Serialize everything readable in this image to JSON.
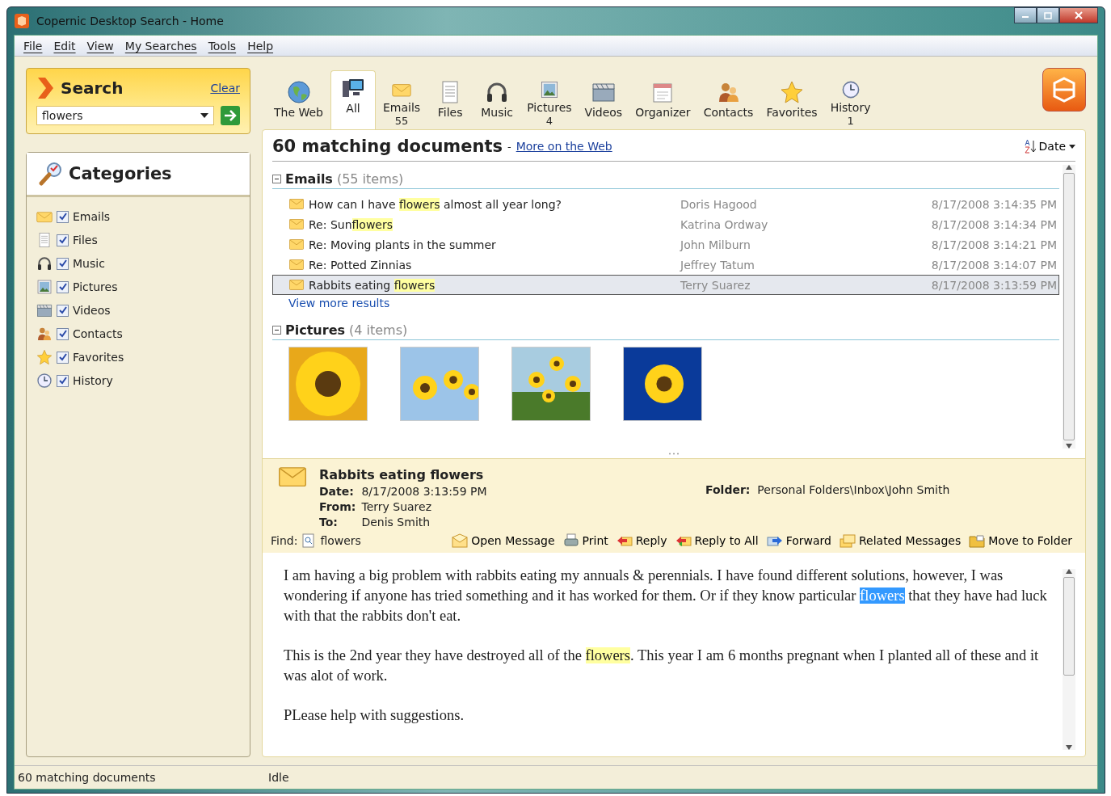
{
  "window": {
    "title": "Copernic Desktop Search - Home"
  },
  "menu": [
    "File",
    "Edit",
    "View",
    "My Searches",
    "Tools",
    "Help"
  ],
  "search": {
    "title": "Search",
    "clear": "Clear",
    "value": "flowers"
  },
  "categories": {
    "title": "Categories",
    "items": [
      {
        "kind": "email",
        "label": "Emails",
        "checked": true
      },
      {
        "kind": "file",
        "label": "Files",
        "checked": true
      },
      {
        "kind": "music",
        "label": "Music",
        "checked": true
      },
      {
        "kind": "picture",
        "label": "Pictures",
        "checked": true
      },
      {
        "kind": "video",
        "label": "Videos",
        "checked": true
      },
      {
        "kind": "contact",
        "label": "Contacts",
        "checked": true
      },
      {
        "kind": "favorite",
        "label": "Favorites",
        "checked": true
      },
      {
        "kind": "history",
        "label": "History",
        "checked": true
      }
    ]
  },
  "tabs": [
    {
      "kind": "web",
      "label": "The Web",
      "selected": false
    },
    {
      "kind": "all",
      "label": "All",
      "selected": true
    },
    {
      "kind": "email",
      "label": "Emails",
      "count": "55",
      "selected": false
    },
    {
      "kind": "file",
      "label": "Files",
      "selected": false
    },
    {
      "kind": "music",
      "label": "Music",
      "selected": false
    },
    {
      "kind": "picture",
      "label": "Pictures",
      "count": "4",
      "selected": false
    },
    {
      "kind": "video",
      "label": "Videos",
      "selected": false
    },
    {
      "kind": "organizer",
      "label": "Organizer",
      "selected": false
    },
    {
      "kind": "contact",
      "label": "Contacts",
      "selected": false
    },
    {
      "kind": "favorite",
      "label": "Favorites",
      "selected": false
    },
    {
      "kind": "history",
      "label": "History",
      "count": "1",
      "selected": false
    }
  ],
  "results": {
    "heading": "60 matching documents",
    "separator": "-",
    "web_link": "More on the Web",
    "sort": "Date",
    "emails": {
      "title": "Emails",
      "count": "(55 items)",
      "more": "View more results",
      "rows": [
        {
          "subject": [
            {
              "text": "How can I have ",
              "highlight": false
            },
            {
              "text": "flowers",
              "highlight": true
            },
            {
              "text": " almost all year long?",
              "highlight": false
            }
          ],
          "from": "Doris Hagood",
          "date": "8/17/2008 3:14:35 PM",
          "selected": false
        },
        {
          "subject": [
            {
              "text": "Re: Sun",
              "highlight": false
            },
            {
              "text": "flowers",
              "highlight": true
            }
          ],
          "from": "Katrina Ordway",
          "date": "8/17/2008 3:14:34 PM",
          "selected": false
        },
        {
          "subject": [
            {
              "text": "Re: Moving plants in the summer",
              "highlight": false
            }
          ],
          "from": "John Milburn",
          "date": "8/17/2008 3:14:21 PM",
          "selected": false
        },
        {
          "subject": [
            {
              "text": "Re: Potted Zinnias",
              "highlight": false
            }
          ],
          "from": "Jeffrey Tatum",
          "date": "8/17/2008 3:14:07 PM",
          "selected": false
        },
        {
          "subject": [
            {
              "text": "Rabbits eating ",
              "highlight": false
            },
            {
              "text": "flowers",
              "highlight": true
            }
          ],
          "from": "Terry Suarez",
          "date": "8/17/2008 3:13:59 PM",
          "selected": true
        }
      ]
    },
    "pictures": {
      "title": "Pictures",
      "count": "(4 items)",
      "items": [
        {
          "kind": "closeup"
        },
        {
          "kind": "sky"
        },
        {
          "kind": "field"
        },
        {
          "kind": "blue"
        }
      ]
    }
  },
  "preview": {
    "title": "Rabbits eating flowers",
    "fields": [
      {
        "label": "Date:",
        "value": "8/17/2008 3:13:59 PM"
      },
      {
        "label": "From:",
        "value": "Terry Suarez"
      },
      {
        "label": "To:",
        "value": "Denis Smith"
      }
    ],
    "folder": {
      "label": "Folder:",
      "value": "Personal Folders\\Inbox\\John Smith"
    },
    "find": {
      "label": "Find:",
      "value": "flowers"
    },
    "actions": [
      {
        "kind": "open",
        "label": "Open Message"
      },
      {
        "kind": "print",
        "label": "Print"
      },
      {
        "kind": "reply",
        "label": "Reply"
      },
      {
        "kind": "replyall",
        "label": "Reply to All"
      },
      {
        "kind": "forward",
        "label": "Forward"
      },
      {
        "kind": "related",
        "label": "Related Messages"
      },
      {
        "kind": "move",
        "label": "Move to Folder"
      }
    ],
    "body": [
      [
        {
          "text": "I am having a big problem with rabbits eating my annuals & perennials. I have found different solutions, however, I was wondering if anyone has tried something and it has worked for them. Or if they know particular ",
          "highlight": false,
          "selected": false
        },
        {
          "text": "flowers",
          "selected": true
        },
        {
          "text": " that they have had luck with that the rabbits don't eat.",
          "highlight": false,
          "selected": false
        }
      ],
      [
        {
          "text": "This is the 2nd year they have destroyed all of the ",
          "highlight": false,
          "selected": false
        },
        {
          "text": "flowers",
          "highlight": true,
          "selected": false
        },
        {
          "text": ". This year I am 6 months pregnant when I planted all of these and it was alot of work.",
          "highlight": false,
          "selected": false
        }
      ],
      [
        {
          "text": "PLease help with suggestions.",
          "highlight": false,
          "selected": false
        }
      ]
    ]
  },
  "status_bar": [
    "60 matching documents",
    "Idle"
  ]
}
